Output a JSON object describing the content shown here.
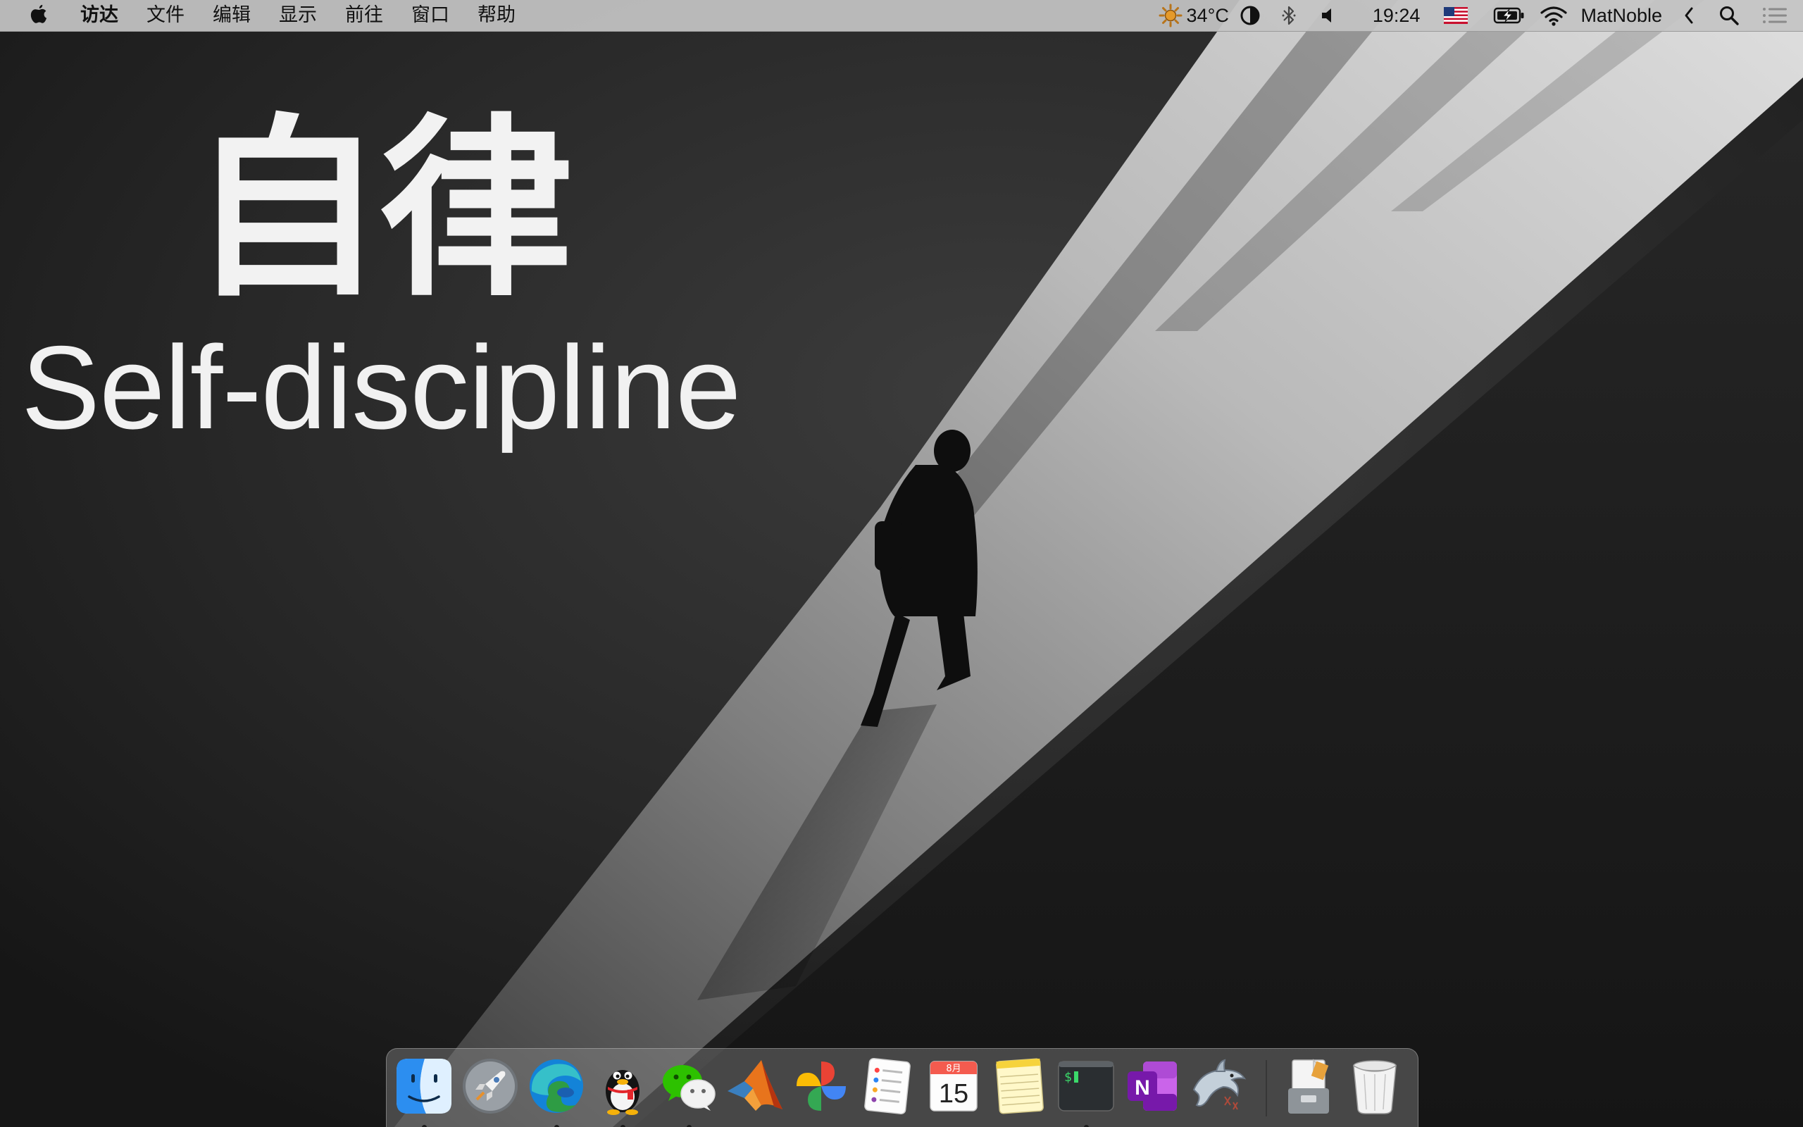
{
  "menubar": {
    "app_menus": [
      "访达",
      "文件",
      "编辑",
      "显示",
      "前往",
      "窗口",
      "帮助"
    ],
    "status": {
      "weather_icon": "sun-icon",
      "temperature": "34°C",
      "contrast_icon": "dark-mode-toggle-icon",
      "bluetooth_icon": "bluetooth-icon",
      "volume_icon": "volume-icon",
      "time": "19:24",
      "input_source_icon": "us-flag-icon",
      "battery_icon": "battery-charging-icon",
      "wifi_icon": "wifi-icon",
      "username": "MatNoble",
      "collapse_icon": "chevron-left-icon",
      "spotlight_icon": "search-icon",
      "notification_icon": "notification-center-icon"
    }
  },
  "wallpaper": {
    "title_cn": "自律",
    "title_en": "Self-discipline"
  },
  "dock": {
    "apps": [
      {
        "name": "finder",
        "running": true
      },
      {
        "name": "launchpad",
        "running": false
      },
      {
        "name": "microsoft-edge",
        "running": true
      },
      {
        "name": "qq",
        "running": true
      },
      {
        "name": "wechat",
        "running": true
      },
      {
        "name": "matlab",
        "running": false
      },
      {
        "name": "google-photos",
        "running": false
      },
      {
        "name": "reminders",
        "running": false
      },
      {
        "name": "calendar",
        "running": false,
        "month": "8月",
        "day": "15"
      },
      {
        "name": "notes",
        "running": false
      },
      {
        "name": "terminal",
        "running": true
      },
      {
        "name": "onenote",
        "running": false
      },
      {
        "name": "dolphin",
        "running": false
      },
      {
        "name": "downloads-stack",
        "running": false
      },
      {
        "name": "trash",
        "running": false
      }
    ]
  },
  "colors": {
    "menubar_bg": "#c4c4c4",
    "wallpaper_dark": "#1c1c1c",
    "light_beam": "#d6d6d6",
    "title_text": "#f2f2f2"
  }
}
